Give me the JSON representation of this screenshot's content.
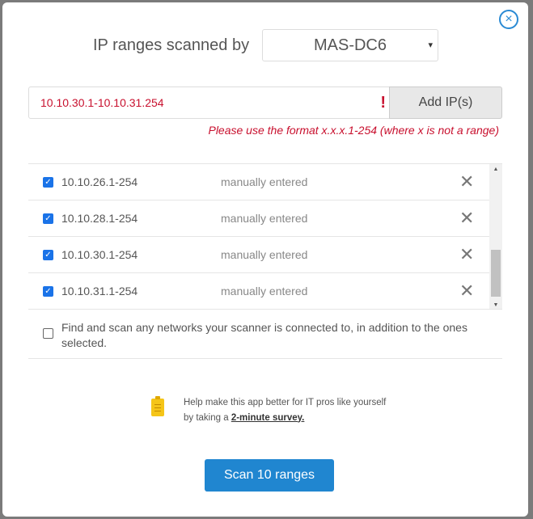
{
  "header": {
    "title": "IP ranges scanned by",
    "scanner": "MAS-DC6",
    "dropdown_arrow": "▾",
    "close_icon": "×"
  },
  "ip_entry": {
    "value": "10.10.30.1-10.10.31.254",
    "error_mark": "!",
    "add_label": "Add IP(s)",
    "error_text": "Please use the format x.x.x.1-254 (where x is not a range)"
  },
  "ranges": [
    {
      "ip": "10.10.26.1-254",
      "source": "manually entered",
      "checked": true
    },
    {
      "ip": "10.10.28.1-254",
      "source": "manually entered",
      "checked": true
    },
    {
      "ip": "10.10.30.1-254",
      "source": "manually entered",
      "checked": true
    },
    {
      "ip": "10.10.31.1-254",
      "source": "manually entered",
      "checked": true
    }
  ],
  "find_networks": {
    "label": "Find and scan any networks your scanner is connected to, in addition to the ones selected.",
    "checked": false
  },
  "survey": {
    "text": "Help make this app better for IT pros like yourself by taking a ",
    "link": "2-minute survey."
  },
  "scan_button": "Scan 10 ranges",
  "colors": {
    "accent": "#2086d0",
    "error": "#c8102e"
  }
}
